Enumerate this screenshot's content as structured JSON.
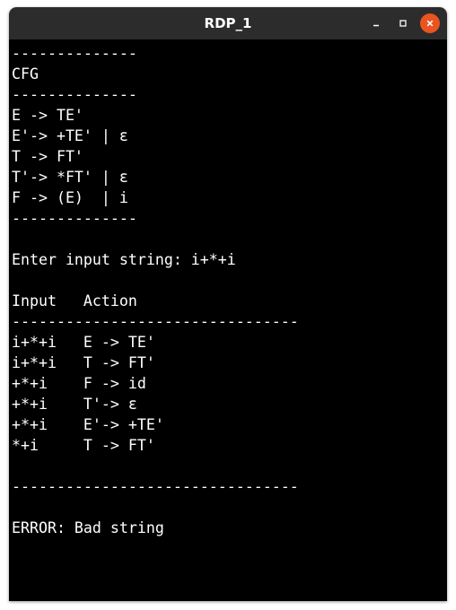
{
  "window": {
    "title": "RDP_1",
    "colors": {
      "titlebar": "#2c2c2c",
      "close": "#e95420",
      "terminal_bg": "#000000",
      "terminal_fg": "#ffffff"
    },
    "controls": [
      "minimize-icon",
      "maximize-icon",
      "close-icon"
    ]
  },
  "terminal": {
    "lines": [
      "--------------",
      "CFG",
      "--------------",
      "E -> TE'",
      "E'-> +TE' | ε",
      "T -> FT'",
      "T'-> *FT' | ε",
      "F -> (E)  | i",
      "--------------",
      "",
      "Enter input string: i+*+i",
      "",
      "Input   Action",
      "--------------------------------",
      "i+*+i   E -> TE'",
      "i+*+i   T -> FT'",
      "+*+i    F -> id",
      "+*+i    T'-> ε",
      "+*+i    E'-> +TE'",
      "*+i     T -> FT'",
      "",
      "--------------------------------",
      "",
      "ERROR: Bad string"
    ]
  }
}
